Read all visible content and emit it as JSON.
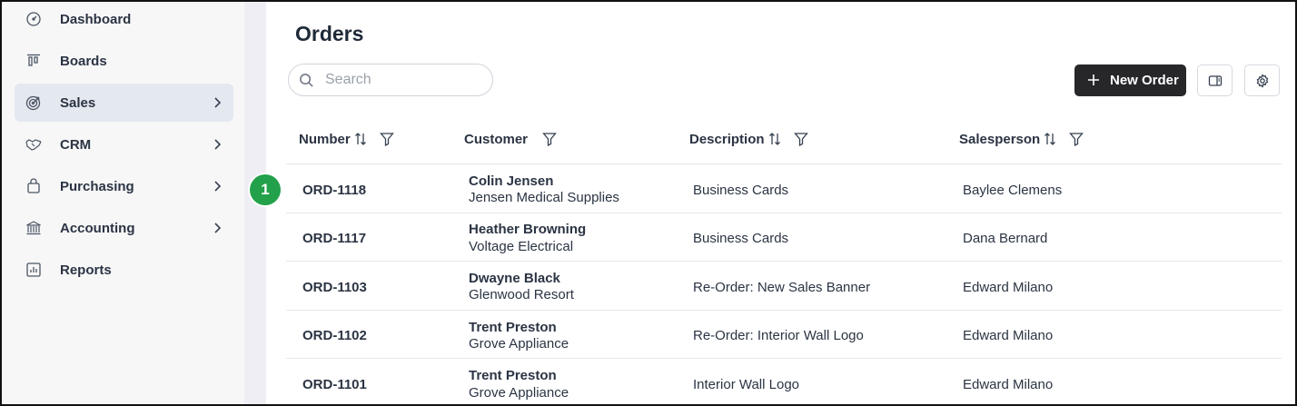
{
  "sidebar": {
    "items": [
      {
        "label": "Dashboard",
        "icon": "gauge-icon",
        "active": false,
        "has_submenu": false
      },
      {
        "label": "Boards",
        "icon": "kanban-icon",
        "active": false,
        "has_submenu": false
      },
      {
        "label": "Sales",
        "icon": "target-icon",
        "active": true,
        "has_submenu": true
      },
      {
        "label": "CRM",
        "icon": "handshake-icon",
        "active": false,
        "has_submenu": true
      },
      {
        "label": "Purchasing",
        "icon": "shopping-bag-icon",
        "active": false,
        "has_submenu": true
      },
      {
        "label": "Accounting",
        "icon": "bank-icon",
        "active": false,
        "has_submenu": true
      },
      {
        "label": "Reports",
        "icon": "bar-chart-icon",
        "active": false,
        "has_submenu": false
      }
    ]
  },
  "page": {
    "title": "Orders"
  },
  "search": {
    "placeholder": "Search",
    "value": ""
  },
  "toolbar": {
    "new_order_label": "New Order"
  },
  "table": {
    "columns": {
      "number": "Number",
      "customer": "Customer",
      "description": "Description",
      "salesperson": "Salesperson"
    },
    "rows": [
      {
        "number": "ORD-1118",
        "customer_name": "Colin Jensen",
        "customer_company": "Jensen Medical Supplies",
        "description": "Business Cards",
        "salesperson": "Baylee Clemens"
      },
      {
        "number": "ORD-1117",
        "customer_name": "Heather Browning",
        "customer_company": "Voltage Electrical",
        "description": "Business Cards",
        "salesperson": "Dana Bernard"
      },
      {
        "number": "ORD-1103",
        "customer_name": "Dwayne Black",
        "customer_company": "Glenwood Resort",
        "description": "Re-Order: New Sales Banner",
        "salesperson": "Edward Milano"
      },
      {
        "number": "ORD-1102",
        "customer_name": "Trent Preston",
        "customer_company": "Grove Appliance",
        "description": "Re-Order: Interior Wall Logo",
        "salesperson": "Edward Milano"
      },
      {
        "number": "ORD-1101",
        "customer_name": "Trent Preston",
        "customer_company": "Grove Appliance",
        "description": "Interior Wall Logo",
        "salesperson": "Edward Milano"
      }
    ]
  },
  "annotation": {
    "badge_label": "1",
    "color": "#23a14a"
  },
  "colors": {
    "primary_button": "#27272a",
    "active_nav": "#e4e8ef",
    "sidebar_bg": "#f7f7f8"
  }
}
